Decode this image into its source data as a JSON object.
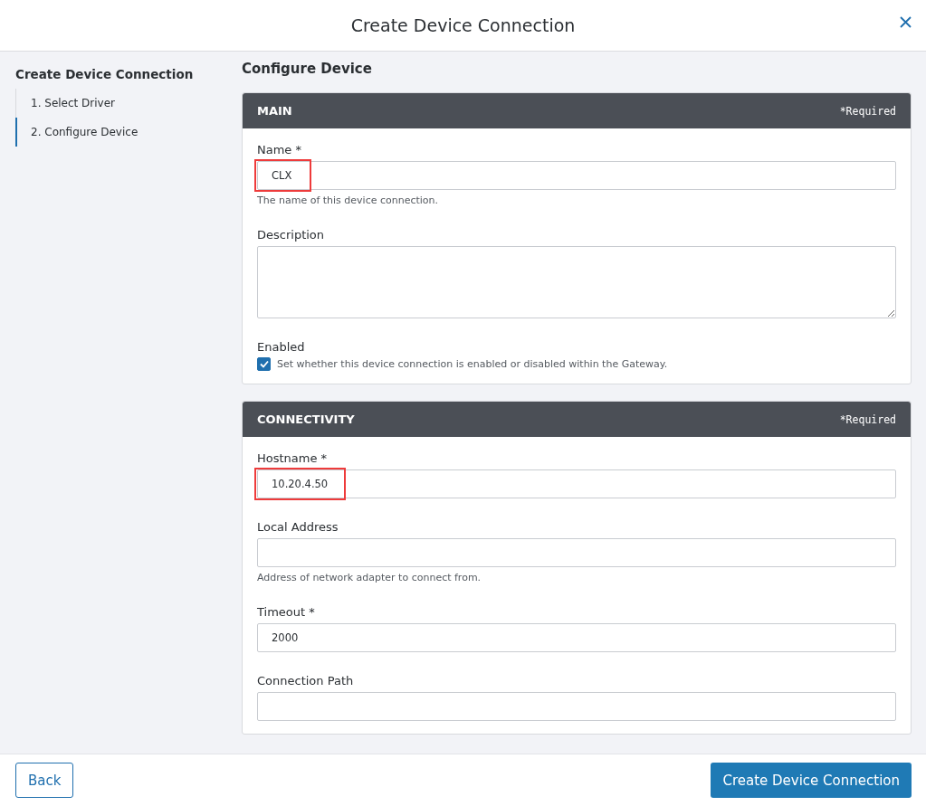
{
  "window": {
    "title": "Create Device Connection"
  },
  "sidebar": {
    "title": "Create Device Connection",
    "steps": [
      {
        "label": "1. Select Driver",
        "selected": false
      },
      {
        "label": "2. Configure Device",
        "selected": true
      }
    ]
  },
  "page_title": "Configure Device",
  "sections": [
    {
      "title": "MAIN",
      "note": "*Required",
      "fields": [
        {
          "kind": "text",
          "label": "Name *",
          "value": "CLX",
          "help": "The name of this device connection.",
          "highlighted": true
        },
        {
          "kind": "textarea",
          "label": "Description"
        },
        {
          "kind": "checkbox",
          "label": "Enabled",
          "text": "Set whether this device connection is enabled or disabled within the Gateway.",
          "checked": true
        }
      ]
    },
    {
      "title": "CONNECTIVITY",
      "note": "*Required",
      "fields": [
        {
          "kind": "text",
          "label": "Hostname *",
          "value": "10.20.4.50",
          "highlighted": true
        },
        {
          "kind": "text",
          "label": "Local Address",
          "help": "Address of network adapter to connect from.",
          "highlighted": false
        },
        {
          "kind": "text",
          "label": "Timeout *",
          "value": "2000",
          "highlighted": false
        },
        {
          "kind": "text",
          "label": "Connection Path",
          "highlighted": false
        }
      ]
    }
  ],
  "footer": {
    "back": "Back",
    "submit": "Create Device Connection"
  }
}
